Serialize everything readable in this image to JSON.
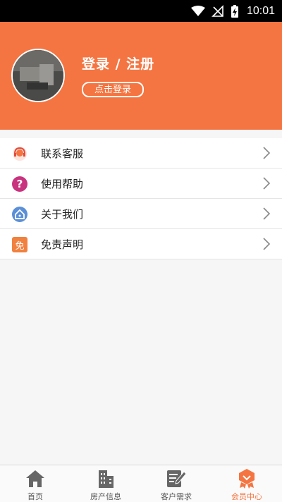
{
  "status_bar": {
    "time": "10:01"
  },
  "profile": {
    "title": "登录 / 注册",
    "login_button": "点击登录"
  },
  "menu": {
    "items": [
      {
        "label": "联系客服",
        "icon": "customer-service-icon"
      },
      {
        "label": "使用帮助",
        "icon": "question-icon"
      },
      {
        "label": "关于我们",
        "icon": "home-icon"
      },
      {
        "label": "免责声明",
        "icon": "disclaimer-icon",
        "icon_text": "免"
      }
    ]
  },
  "tabbar": {
    "tabs": [
      {
        "label": "首页",
        "icon": "home-icon"
      },
      {
        "label": "房产信息",
        "icon": "building-icon"
      },
      {
        "label": "客户需求",
        "icon": "edit-icon"
      },
      {
        "label": "会员中心",
        "icon": "member-badge-icon",
        "active": true
      }
    ]
  },
  "colors": {
    "accent": "#f47541",
    "background": "#f6f6f6"
  }
}
